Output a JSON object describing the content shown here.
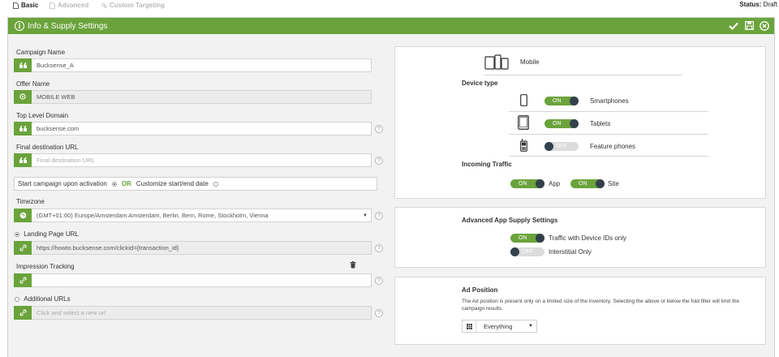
{
  "tabs": [
    {
      "label": "Basic",
      "icon": "file-icon",
      "state": "active"
    },
    {
      "label": "Advanced",
      "icon": "file-icon",
      "state": "disabled"
    },
    {
      "label": "Custom Targeting",
      "icon": "gears-icon",
      "state": "disabled"
    }
  ],
  "status": {
    "label": "Status:",
    "value": "Draft"
  },
  "header": {
    "title": "Info & Supply Settings",
    "accent": "#6aa33b"
  },
  "form": {
    "campaign_name": {
      "label": "Campaign Name",
      "value": "Bucksense_A"
    },
    "offer_name": {
      "label": "Offer Name",
      "value": "MOBILE WEB"
    },
    "top_level_domain": {
      "label": "Top Level Domain",
      "value": "bucksense.com"
    },
    "final_destination": {
      "label": "Final destination URL",
      "placeholder": "Final destination URL"
    },
    "start": {
      "option1": "Start campaign upon activation",
      "or": "OR",
      "option2": "Customize start/end date"
    },
    "timezone": {
      "label": "Timezone",
      "value": "(GMT+01:00) Europe/Amsterdam Amsterdam, Berlin, Bern, Rome, Stockholm, Vienna"
    },
    "landing_page": {
      "label": "Landing Page URL",
      "value": "https://howto.bucksense.com/clickid={transaction_id}"
    },
    "impression_tracking": {
      "label": "Impression Tracking",
      "value": ""
    },
    "additional_urls": {
      "label": "Additional URLs",
      "placeholder": "Click and select a new url"
    },
    "help": "?"
  },
  "device": {
    "platform": "Mobile",
    "device_type_title": "Device type",
    "devices": [
      {
        "label": "Smartphones",
        "toggle": "ON",
        "on": true
      },
      {
        "label": "Tablets",
        "toggle": "ON",
        "on": true
      },
      {
        "label": "Feature phones",
        "toggle": "OFF",
        "on": false
      }
    ],
    "incoming_title": "Incoming Traffic",
    "incoming": [
      {
        "label": "App",
        "toggle": "ON",
        "on": true
      },
      {
        "label": "Site",
        "toggle": "ON",
        "on": true
      }
    ]
  },
  "app_supply": {
    "title": "Advanced App Supply Settings",
    "items": [
      {
        "label": "Traffic with Device IDs only",
        "toggle": "ON",
        "on": true
      },
      {
        "label": "Interstitial Only",
        "toggle": "OFF",
        "on": false
      }
    ]
  },
  "ad_position": {
    "title": "Ad Position",
    "description": "The Ad position is present only on a limited size of the inventory. Selecting the above or below the fold filter will limit the campaign results.",
    "selected": "Everything"
  }
}
